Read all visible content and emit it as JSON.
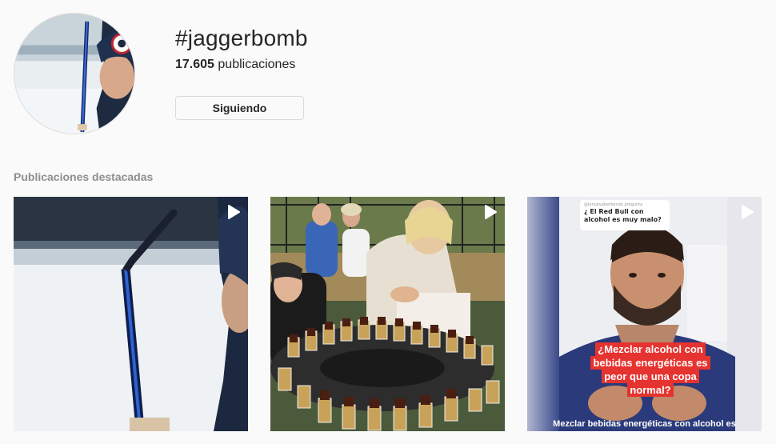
{
  "profile": {
    "hashtag": "#jaggerbomb",
    "posts_count": "17.605",
    "posts_label": "publicaciones",
    "follow_button_label": "Siguiendo"
  },
  "featured": {
    "title": "Publicaciones destacadas",
    "posts": [
      {
        "kind": "video",
        "icon": "play-icon"
      },
      {
        "kind": "video",
        "icon": "play-icon"
      },
      {
        "kind": "video",
        "icon": "play-icon",
        "bubble_user": "@lanuevaberbenda pregunta",
        "bubble_question": "¿ El Red Bull con alcohol es muy malo?",
        "overlay_caption": "¿Mezclar alcohol con bebidas energéticas es peor que una copa normal?",
        "subtitle": "Mezclar bebidas energéticas con alcohol es"
      }
    ]
  },
  "colors": {
    "background": "#fafafa",
    "secondary_text": "#8e8e8e",
    "border": "#dbdbdb",
    "caption_red": "#e5332f"
  }
}
